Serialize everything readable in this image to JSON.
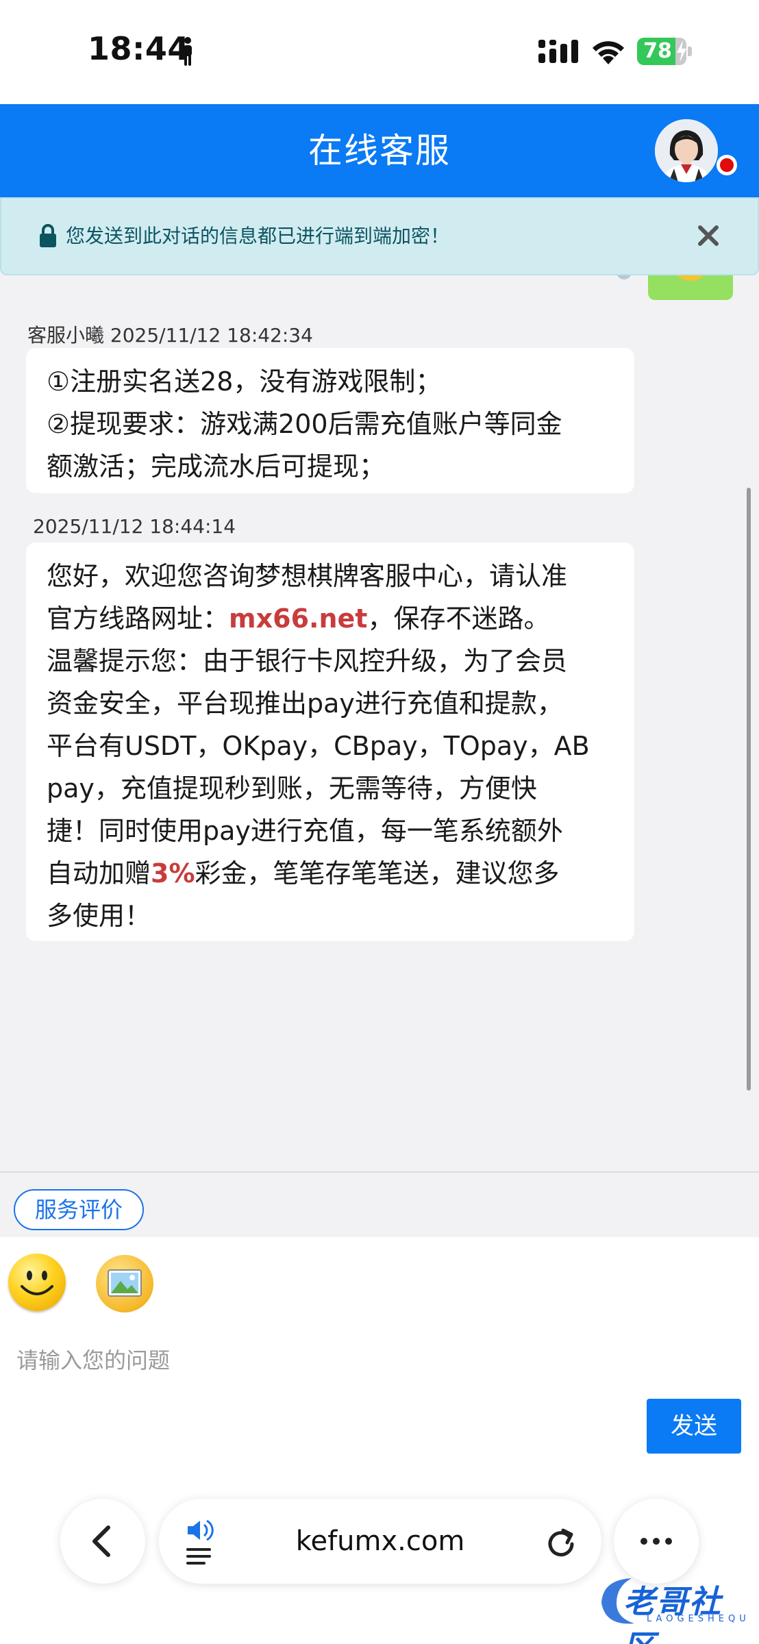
{
  "status_bar": {
    "time": "18:44",
    "battery": "78",
    "battery_level": 0.78
  },
  "header": {
    "title": "在线客服"
  },
  "notice": {
    "text": "您发送到此对话的信息都已进行端到端加密！"
  },
  "messages": [
    {
      "meta": "客服小曦 2025/11/12 18:42:34",
      "lines": [
        "①注册实名送28，没有游戏限制；",
        "②提现要求：游戏满200后需充值账户等同金",
        "额激活；完成流水后可提现；"
      ]
    },
    {
      "meta": "2025/11/12 18:44:14",
      "lines": [
        "您好，欢迎您咨询梦想棋牌客服中心，请认准",
        [
          "官方线路网址：",
          "mx66.net",
          "，保存不迷路。"
        ],
        "温馨提示您：由于银行卡风控升级，为了会员",
        "资金安全，平台现推出pay进行充值和提款，",
        "平台有USDT，OKpay，CBpay，TOpay，AB",
        "pay，充值提现秒到账，无需等待，方便快",
        "捷！同时使用pay进行充值，每一笔系统额外",
        [
          "自动加赠",
          "3%",
          "彩金，笔笔存笔笔送，建议您多"
        ],
        "多使用！"
      ]
    }
  ],
  "rating": {
    "label": "服务评价"
  },
  "composer": {
    "placeholder": "请输入您的问题",
    "send_label": "发送"
  },
  "browser": {
    "url": "kefumx.com"
  },
  "watermark": {
    "text": "老哥社区",
    "sub": "LAOGESHEQU"
  },
  "colors": {
    "header": "#0a7af5",
    "highlight": "#c83c3c",
    "notice_bg": "#d1ecf1",
    "notice_text": "#0c5460"
  }
}
